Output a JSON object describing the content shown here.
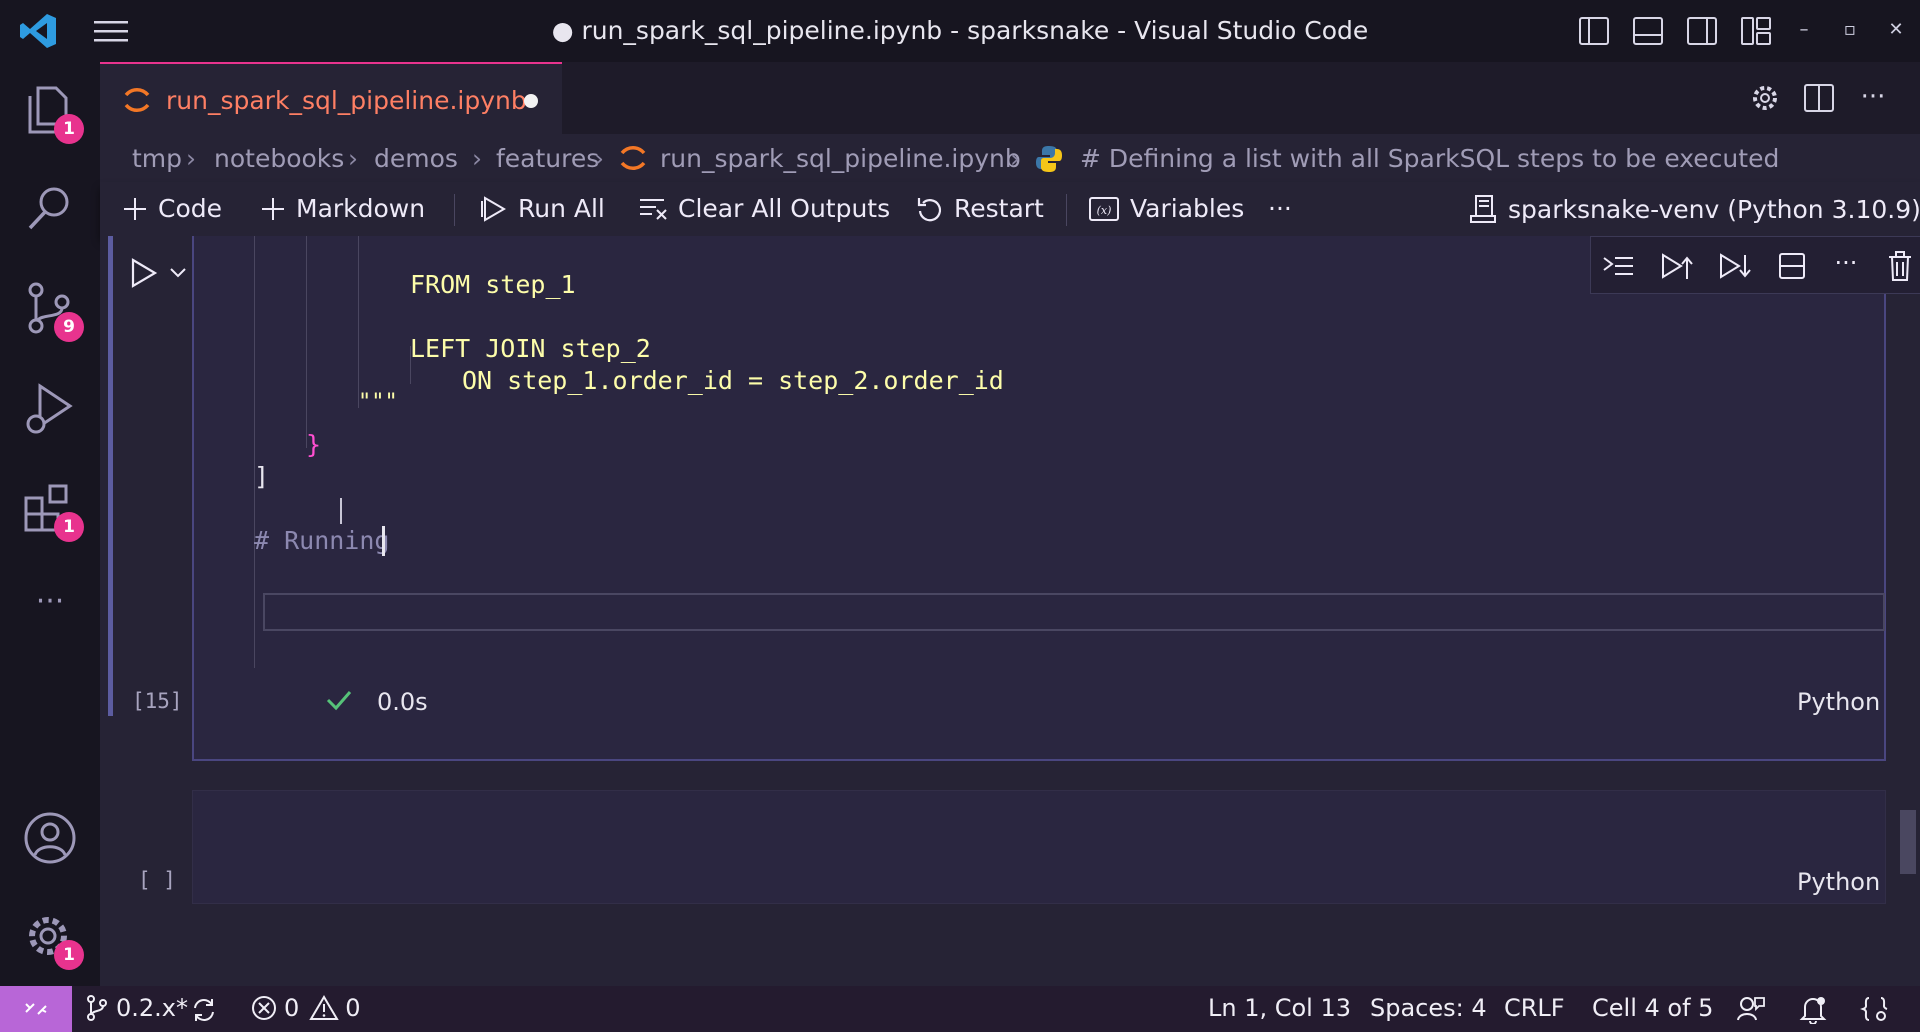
{
  "window": {
    "title": "● run_spark_sql_pipeline.ipynb - sparksnake - Visual Studio Code"
  },
  "activity_bar": {
    "explorer_badge": "1",
    "source_control_badge": "9",
    "extensions_badge": "1",
    "settings_badge": "1"
  },
  "tab": {
    "label": "run_spark_sql_pipeline.ipynb"
  },
  "breadcrumb": {
    "items": [
      "tmp",
      "notebooks",
      "demos",
      "features",
      "run_spark_sql_pipeline.ipynb",
      "# Defining a list with all SparkSQL steps to be executed"
    ]
  },
  "notebook_toolbar": {
    "code": "Code",
    "markdown": "Markdown",
    "run_all": "Run All",
    "clear_outputs": "Clear All Outputs",
    "restart": "Restart",
    "variables": "Variables",
    "more": "···",
    "kernel": "sparksnake-venv (Python 3.10.9)"
  },
  "cell1": {
    "code_lines": [
      "FROM step_1",
      "LEFT JOIN step_2",
      "ON step_1.order_id = step_2.order_id",
      "\"\"\"",
      "}",
      "]",
      "# Running "
    ],
    "exec_count": "[15]",
    "exec_time": "0.0s",
    "language": "Python"
  },
  "cell2": {
    "exec_count": "[ ]",
    "language": "Python"
  },
  "status_bar": {
    "branch": "0.2.x*",
    "errors": "0",
    "warnings": "0",
    "position": "Ln 1, Col 13",
    "spaces": "Spaces: 4",
    "eol": "CRLF",
    "cell": "Cell 4 of 5"
  },
  "colors": {
    "accent": "#e8338e",
    "remote": "#b866d7",
    "string": "#fdfdaa",
    "tab_label": "#fe7f64"
  }
}
